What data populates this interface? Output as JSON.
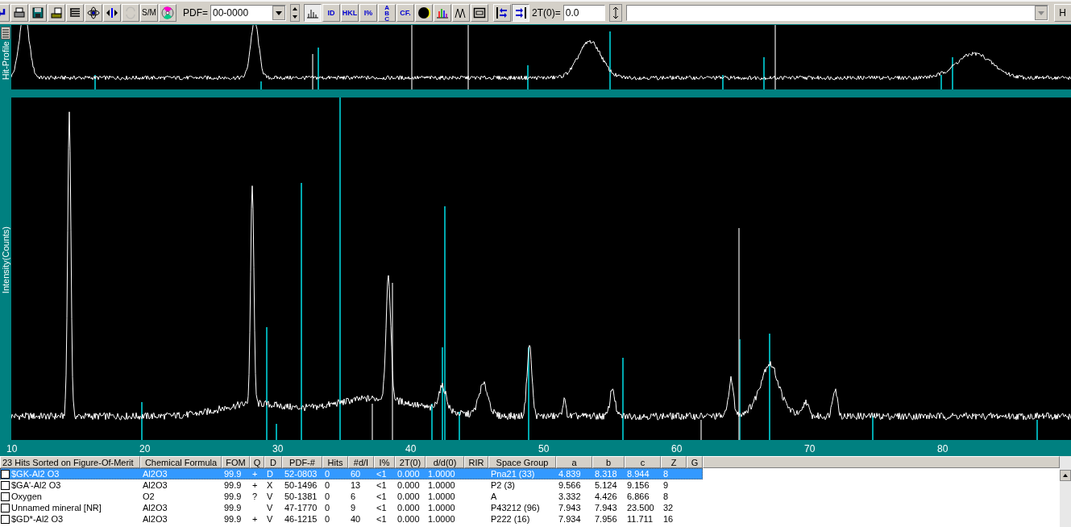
{
  "toolbar": {
    "group_1": [
      {
        "pressed": false,
        "disabled": false
      },
      {
        "pressed": false,
        "disabled": false
      },
      {
        "pressed": false,
        "disabled": false
      },
      {
        "pressed": false,
        "disabled": false
      },
      {
        "pressed": false,
        "disabled": false
      },
      {
        "pressed": false,
        "disabled": false
      },
      {
        "pressed": false,
        "disabled": false
      },
      {
        "pressed": false,
        "disabled": true
      },
      {
        "pressed": false,
        "disabled": false,
        "label": "S/M"
      },
      {
        "pressed": false,
        "disabled": false
      }
    ],
    "pdf": {
      "label": "PDF=",
      "value": "00-0000"
    },
    "group_2": [
      {
        "pressed": true
      },
      {
        "pressed": false,
        "label": "ID"
      },
      {
        "pressed": false,
        "label": "HKL"
      },
      {
        "pressed": false,
        "label": "I%"
      },
      {
        "pressed": false,
        "label": "ABC"
      },
      {
        "pressed": false,
        "label": "CF."
      },
      {
        "pressed": false
      },
      {
        "pressed": false
      },
      {
        "pressed": false
      },
      {
        "pressed": false
      }
    ],
    "group_3": [
      {
        "pressed": false
      },
      {
        "pressed": true
      }
    ],
    "offset": {
      "label": "2T(0)=",
      "value": "0.0"
    },
    "end_button": {
      "label": "H"
    }
  },
  "hit_profile": {
    "label": "Hit-Profile"
  },
  "main_plot": {
    "ylabel": "Intensity(Counts)",
    "x_tick_labels": [
      "10",
      "20",
      "30",
      "40",
      "50",
      "60",
      "70",
      "80"
    ]
  },
  "hit_table": {
    "columns": [
      "23 Hits Sorted on Figure-Of-Merit",
      "Chemical Formula",
      "FOM",
      "Q",
      "D",
      "PDF-#",
      "Hits",
      "#d/I",
      "I%",
      "2T(0)",
      "d/d(0)",
      "RIR",
      "Space Group",
      "a",
      "b",
      "c",
      "Z",
      "G"
    ],
    "rows": [
      {
        "selected": true,
        "checked": false,
        "cells": [
          "$GK-Al2 O3",
          "Al2O3",
          "99.9",
          "+",
          "D",
          "52-0803",
          "0",
          "60",
          "<1",
          "0.000",
          "1.0000",
          null,
          "Pna21 (33)",
          "4.839",
          "8.318",
          "8.944",
          "8"
        ]
      },
      {
        "selected": false,
        "checked": false,
        "cells": [
          "$GA'-Al2 O3",
          "Al2O3",
          "99.9",
          "+",
          "X",
          "50-1496",
          "0",
          "13",
          "<1",
          "0.000",
          "1.0000",
          null,
          "P2 (3)",
          "9.566",
          "5.124",
          "9.156",
          "9"
        ]
      },
      {
        "selected": false,
        "checked": false,
        "cells": [
          "Oxygen",
          "O2",
          "99.9",
          "?",
          "V",
          "50-1381",
          "0",
          "6",
          "<1",
          "0.000",
          "1.0000",
          null,
          "A",
          "3.332",
          "4.426",
          "6.866",
          "8"
        ]
      },
      {
        "selected": false,
        "checked": false,
        "cells": [
          "Unnamed mineral [NR]",
          "Al2O3",
          "99.9",
          null,
          "V",
          "47-1770",
          "0",
          "9",
          "<1",
          "0.000",
          "1.0000",
          null,
          "P43212 (96)",
          "7.943",
          "7.943",
          "23.500",
          "32"
        ]
      },
      {
        "selected": false,
        "checked": false,
        "cells": [
          "$GD*-Al2 O3",
          "Al2O3",
          "99.9",
          "+",
          "V",
          "46-1215",
          "0",
          "40",
          "<1",
          "0.000",
          "1.0000",
          null,
          "P222 (16)",
          "7.934",
          "7.956",
          "11.711",
          "16"
        ]
      }
    ]
  }
}
